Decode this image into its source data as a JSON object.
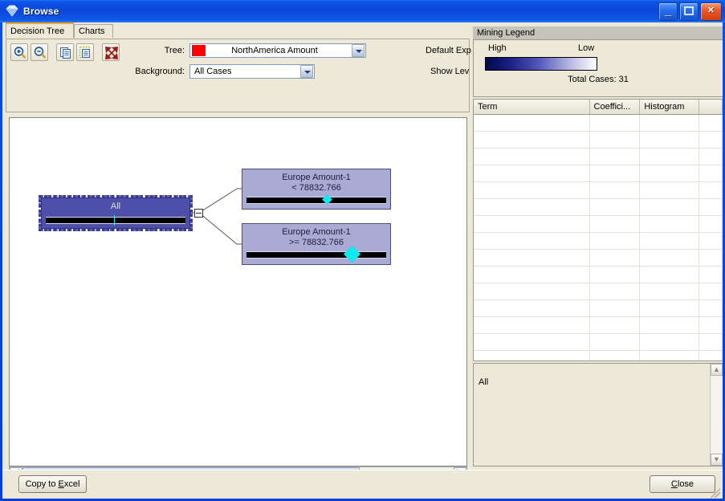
{
  "window": {
    "title": "Browse",
    "icon": "diamond-gem-icon",
    "buttons": {
      "minimize": "minimize-icon",
      "maximize": "maximize-icon",
      "close": "close-icon"
    }
  },
  "tabs": [
    {
      "label": "Decision Tree",
      "active": true
    },
    {
      "label": "Charts",
      "active": false
    }
  ],
  "toolbar": {
    "buttons": [
      {
        "name": "zoom-in-icon",
        "title": "Zoom In"
      },
      {
        "name": "zoom-out-icon",
        "title": "Zoom Out"
      },
      {
        "name": "copy-icon",
        "title": "Copy"
      },
      {
        "name": "copy-image-icon",
        "title": "Copy Image"
      },
      {
        "name": "size-to-fit-icon",
        "title": "Size to Fit"
      }
    ],
    "tree_label": "Tree:",
    "tree_value": "NorthAmerica Amount",
    "tree_swatch_color": "#ff0000",
    "background_label": "Background:",
    "background_value": "All Cases",
    "default_expansion_label": "Default Exp",
    "show_level_label": "Show Lev"
  },
  "tree": {
    "root": {
      "label": "All",
      "marker_position_pct": 50,
      "marker_size": "small"
    },
    "children": [
      {
        "label": "Europe Amount-1\n< 78832.766",
        "marker_position_pct": 57,
        "marker_size": "small"
      },
      {
        "label": "Europe Amount-1\n>= 78832.766",
        "marker_position_pct": 75,
        "marker_size": "large"
      }
    ],
    "connector": "collapse-minus-box"
  },
  "scrollbar": {
    "left_arrow": "◀",
    "right_arrow": "▶"
  },
  "legend": {
    "panel_title": "Mining Legend",
    "gradient_high_label": "High",
    "gradient_low_label": "Low",
    "gradient_high_color": "#06084a",
    "gradient_low_color": "#ffffff",
    "total_cases": "Total Cases: 31",
    "columns": [
      "Term",
      "Coeffici...",
      "Histogram",
      ""
    ],
    "rows": []
  },
  "description": {
    "text": "All",
    "scroll_up": "▲",
    "scroll_down": "▼"
  },
  "footer": {
    "copy_to_excel": "Copy to Excel",
    "copy_to_excel_accel": "E",
    "close": "Close",
    "close_accel": "C"
  }
}
